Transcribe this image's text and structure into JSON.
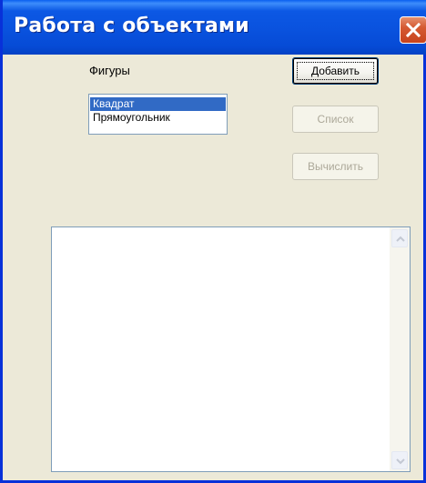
{
  "window": {
    "title": "Работа с объектами"
  },
  "figures": {
    "label": "Фигуры",
    "items": [
      "Квадрат",
      "Прямоугольник"
    ],
    "selected": "Квадрат"
  },
  "buttons": {
    "add": "Добавить",
    "list": "Список",
    "calculate": "Вычислить"
  },
  "memo": {
    "text": ""
  },
  "colors": {
    "title_bar": "#0a53df",
    "selection": "#316ac5",
    "close_button": "#d55a32"
  }
}
